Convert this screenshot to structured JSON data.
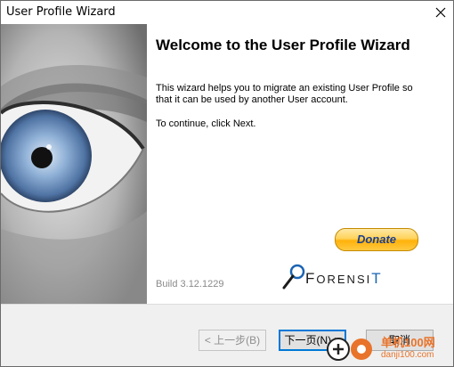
{
  "window": {
    "title": "User Profile Wizard"
  },
  "heading": "Welcome to the User Profile Wizard",
  "description": "This wizard helps you to migrate an existing User Profile so that it can be used by another User account.",
  "instruction": "To continue, click Next.",
  "donate_label": "Donate",
  "build": "Build 3.12.1229",
  "logo": {
    "part1": "F",
    "part2": "ORENSI",
    "part3": "T"
  },
  "buttons": {
    "back": "< 上一步(B)",
    "next": "下一页(N) >",
    "cancel": "取消"
  },
  "watermark": {
    "site": "单机100网",
    "url": "danji100.com"
  },
  "colors": {
    "accent": "#0078d7",
    "donate": "#ffc940",
    "logo": "#1a64b4",
    "watermark": "#e8732a"
  }
}
